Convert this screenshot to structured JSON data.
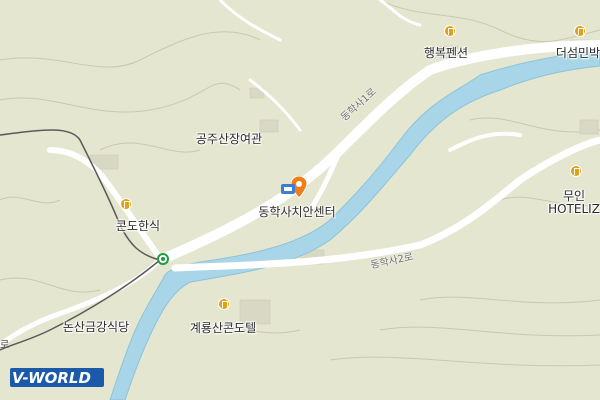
{
  "labels": {
    "center": "동학사치안센터",
    "gongju": "공주산장여관",
    "haengbok": "행복펜션",
    "deoseom": "더섬민박",
    "konchohansik": "콘도한식",
    "muin": "무인",
    "hotel": "HOTELIZ",
    "nonsan": "논산금강식당",
    "gyeryong": "계룡산콘도텔"
  },
  "roads": {
    "road1": "동학사1로",
    "road2": "동학사2로"
  },
  "edge_text": "로",
  "logo": {
    "text": "V-WORLD"
  },
  "colors": {
    "land": "#e4e6cf",
    "water": "#a8d6e8",
    "road": "#ffffff",
    "poi": "#e0a01a",
    "pin": "#f07d1a"
  }
}
